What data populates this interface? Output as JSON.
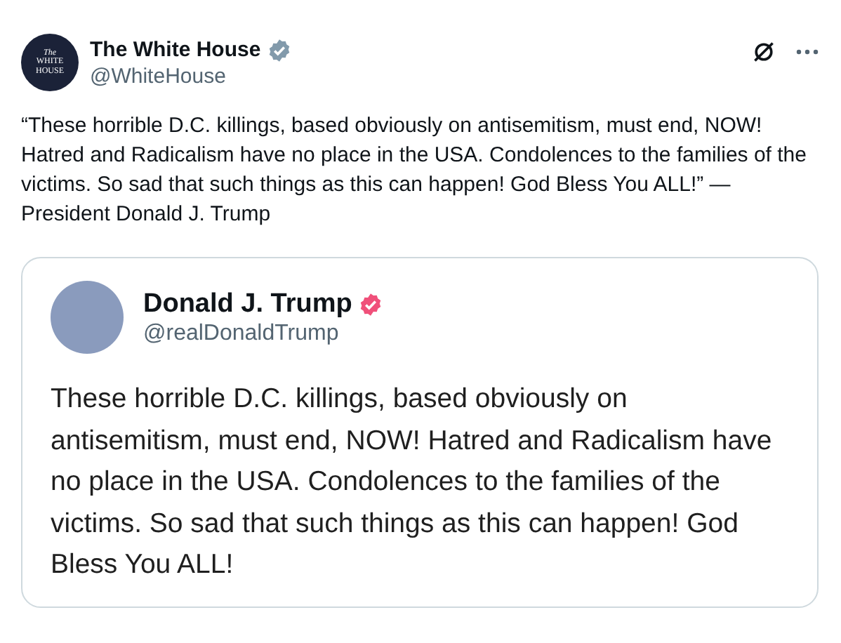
{
  "post": {
    "author": {
      "name": "The White House",
      "handle": "@WhiteHouse",
      "verified": true,
      "avatar_text": [
        "The",
        "WHITE",
        "HOUSE"
      ]
    },
    "text": "“These horrible D.C. killings, based obviously on antisemitism, must end, NOW! Hatred and Radicalism have no place in the USA. Condolences to the families of the victims. So sad that such things as this can happen! God Bless You ALL!” —President Donald J. Trump",
    "quote": {
      "author": {
        "name": "Donald J. Trump",
        "handle": "@realDonaldTrump",
        "verified": true
      },
      "text": "These horrible D.C. killings, based obviously on antisemitism, must end, NOW! Hatred and Radicalism have no place in the USA. Condolences to the families of the victims. So sad that such things as this can happen! God Bless You ALL!"
    }
  }
}
